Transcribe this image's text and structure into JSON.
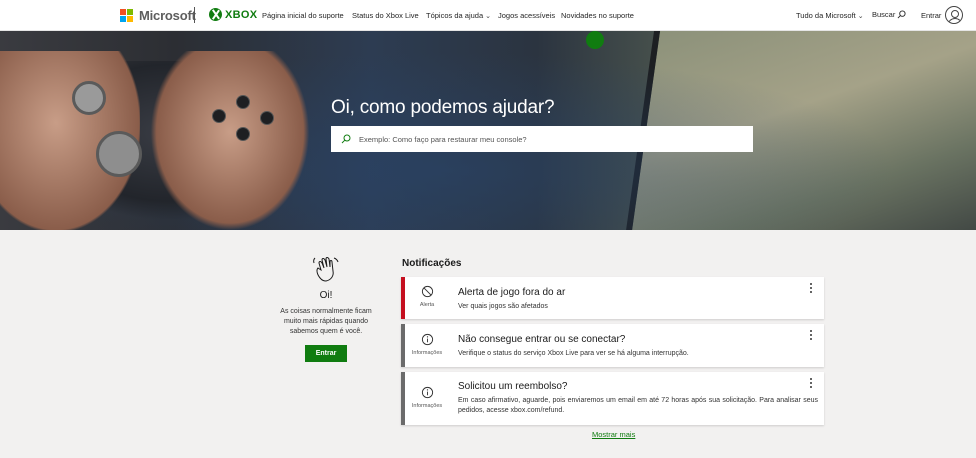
{
  "header": {
    "brand": "Microsoft",
    "xbox": "XBOX",
    "nav": [
      {
        "label": "Página inicial do suporte"
      },
      {
        "label": "Status do Xbox Live"
      },
      {
        "label": "Tópicos da ajuda"
      },
      {
        "label": "Jogos acessíveis"
      },
      {
        "label": "Novidades no suporte"
      }
    ],
    "all_microsoft": "Tudo da Microsoft",
    "search": "Buscar",
    "signin": "Entrar"
  },
  "hero": {
    "title": "Oi, como podemos ajudar?",
    "search_placeholder": "Exemplo: Como faço para restaurar meu console?"
  },
  "greeting": {
    "title": "Oi!",
    "description": "As coisas normalmente ficam muito mais rápidas quando sabemos quem é você.",
    "button": "Entrar"
  },
  "notifications": {
    "heading": "Notificações",
    "items": [
      {
        "icon_label": "Alerta",
        "title": "Alerta de jogo fora do ar",
        "text": "Ver quais jogos são afetados"
      },
      {
        "icon_label": "Informações",
        "title": "Não consegue entrar ou se conectar?",
        "text": "Verifique o status do serviço Xbox Live para ver se há alguma interrupção."
      },
      {
        "icon_label": "Informações",
        "title": "Solicitou um reembolso?",
        "text": "Em caso afirmativo, aguarde, pois enviaremos um email em até 72 horas após sua solicitação. Para analisar seus pedidos, acesse xbox.com/refund."
      }
    ],
    "show_more": "Mostrar mais"
  },
  "colors": {
    "xbox_green": "#107c10",
    "alert_red": "#c50f1f",
    "info_gray": "#6b6b6b"
  }
}
